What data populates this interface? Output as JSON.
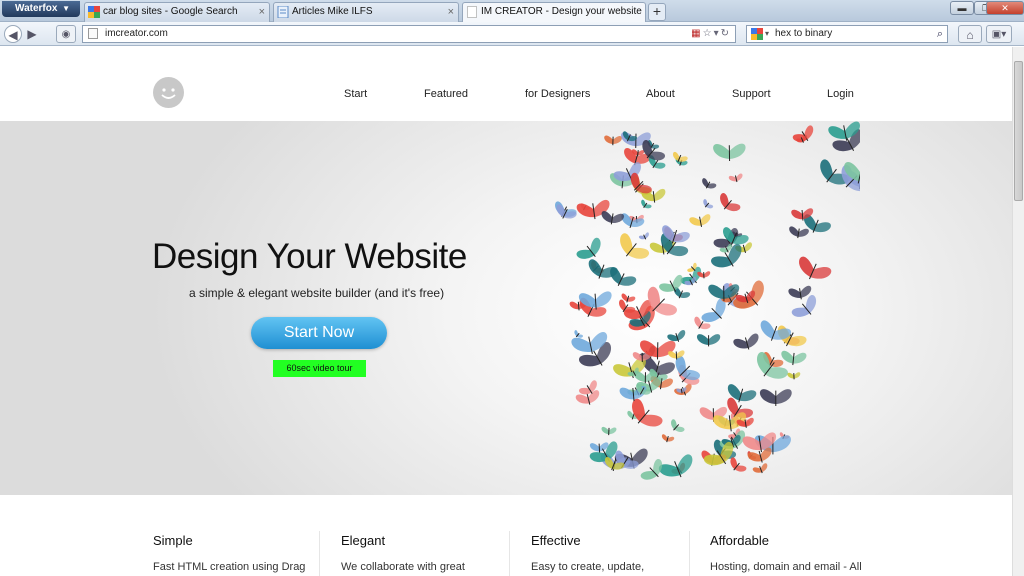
{
  "browser": {
    "app_menu": "Waterfox",
    "tabs": [
      {
        "title": "car blog sites - Google Search"
      },
      {
        "title": "Articles Mike ILFS"
      },
      {
        "title": "IM CREATOR - Design your website"
      }
    ],
    "new_tab": "+",
    "url": "imcreator.com",
    "search_query": "hex to binary"
  },
  "site": {
    "nav": [
      "Start",
      "Featured",
      "for Designers",
      "About",
      "Support",
      "Login"
    ],
    "hero": {
      "title": "Design Your Website",
      "subtitle": "a simple & elegant website builder (and it's free)",
      "cta": "Start Now",
      "video_link": "60sec video tour"
    },
    "features": [
      {
        "title": "Simple",
        "text": "Fast HTML creation using Drag"
      },
      {
        "title": "Elegant",
        "text": "We collaborate with great"
      },
      {
        "title": "Effective",
        "text": "Easy to create, update,"
      },
      {
        "title": "Affordable",
        "text": "Hosting, domain and email - All"
      }
    ]
  },
  "colors": {
    "cta": "#2fa3e6",
    "video_tour_bg": "#22ff22"
  }
}
